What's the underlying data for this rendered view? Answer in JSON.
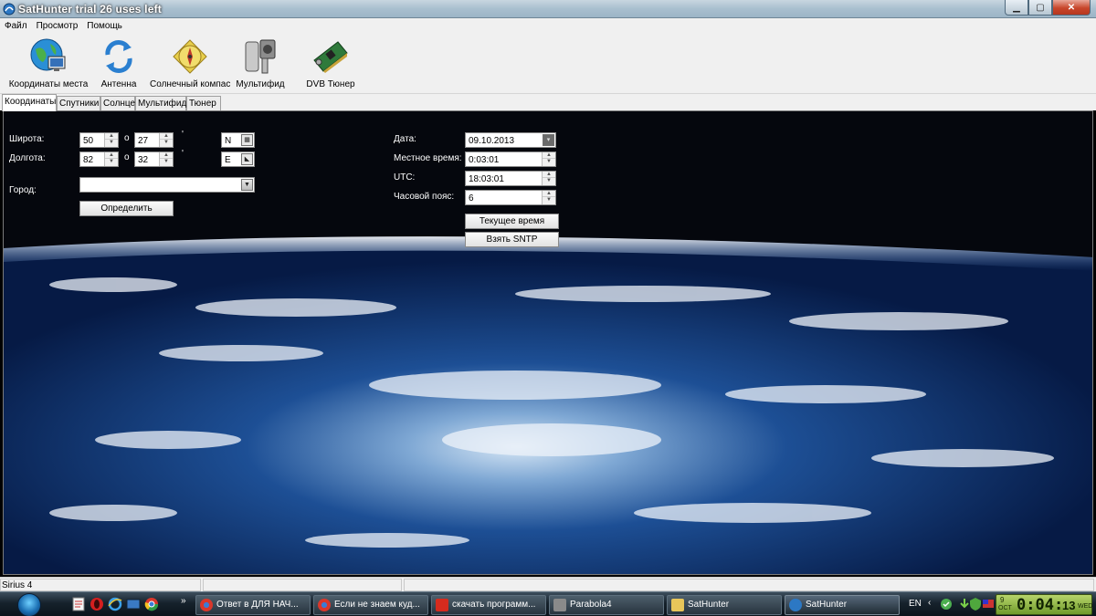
{
  "window": {
    "title": "SatHunter trial 26 uses left"
  },
  "menu": [
    "Файл",
    "Просмотр",
    "Помощь"
  ],
  "toolbar": {
    "coords": "Координаты места",
    "antenna": "Антенна",
    "compass": "Солнечный компас",
    "multifeed": "Мультифид",
    "tuner": "DVB Тюнер"
  },
  "tabs": [
    "Координаты",
    "Спутники",
    "Солнце",
    "Мультифид",
    "Тюнер"
  ],
  "location": {
    "latitude_label": "Широта:",
    "longitude_label": "Долгота:",
    "city_label": "Город:",
    "lat_deg": "50",
    "lat_min": "27",
    "lat_hemisphere": "N",
    "lon_deg": "82",
    "lon_min": "32",
    "lon_hemisphere": "E",
    "degree_sign": "о",
    "minute_sign": "'",
    "city_value": "",
    "detect_button": "Определить"
  },
  "time": {
    "date_label": "Дата:",
    "local_label": "Местное время:",
    "utc_label": "UTC:",
    "tz_label": "Часовой пояс:",
    "date_value": "09.10.2013",
    "local_value": "0:03:01",
    "utc_value": "18:03:01",
    "tz_value": "6",
    "current_time_button": "Текущее время",
    "sntp_button": "Взять SNTP"
  },
  "status": {
    "pane1": "Sirius 4"
  },
  "taskbar": {
    "tasks": [
      "Ответ в ДЛЯ НАЧ...",
      "Если не знаем куд...",
      "скачать программ...",
      "Parabola4",
      "SatHunter",
      "SatHunter"
    ],
    "lang": "EN",
    "clock_month": "OCT",
    "clock_day": "9",
    "clock_time": "0:04:",
    "clock_sec": "13",
    "clock_weekday": "WED"
  },
  "colors": {
    "title_bar": "#a9bfcf",
    "taskbar": "#16222c",
    "earth_ocean": "#0a2c66",
    "space": "#05070d"
  }
}
